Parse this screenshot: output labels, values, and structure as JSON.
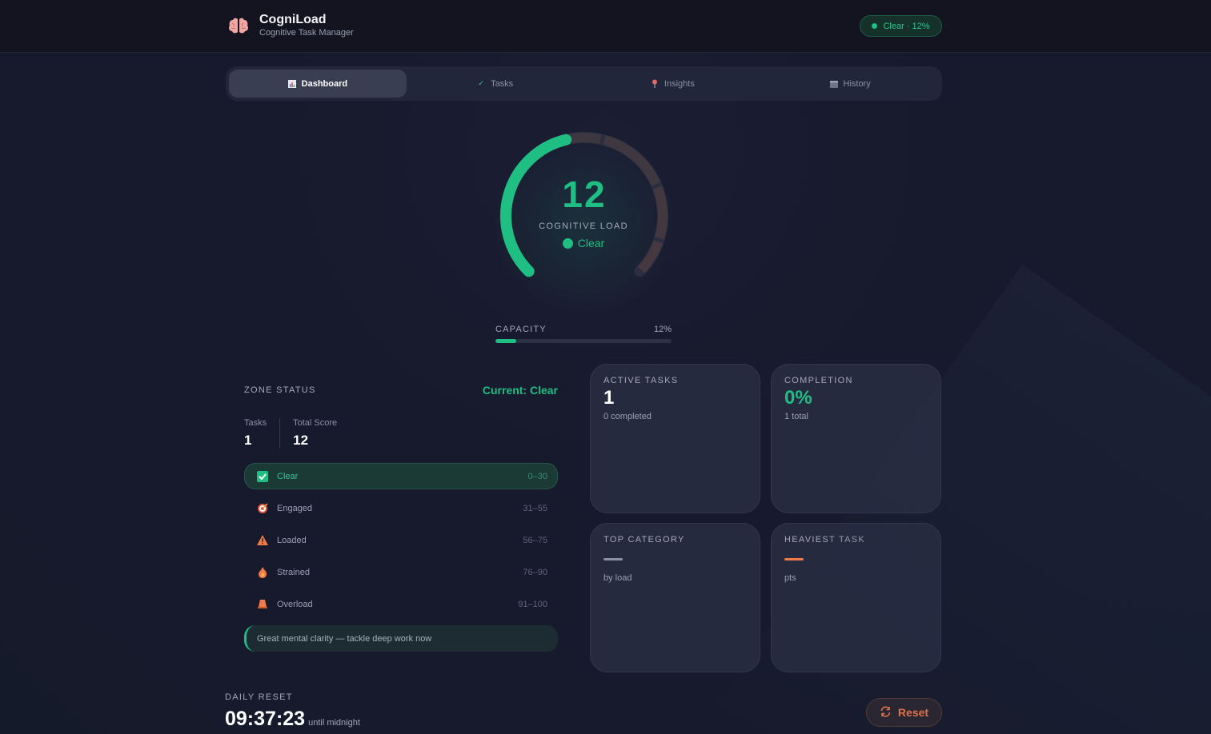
{
  "app": {
    "title": "CogniLoad",
    "subtitle": "Cognitive Task Manager",
    "logo_icon": "brain-icon"
  },
  "header_status": {
    "text": "Clear · 12%",
    "color": "#1fbf84"
  },
  "tabs": [
    {
      "label": "Dashboard",
      "icon": "chart-icon",
      "active": true
    },
    {
      "label": "Tasks",
      "icon": "check-icon",
      "active": false
    },
    {
      "label": "Insights",
      "icon": "pin-icon",
      "active": false
    },
    {
      "label": "History",
      "icon": "calendar-icon",
      "active": false
    }
  ],
  "gauge": {
    "value": "12",
    "label": "COGNITIVE LOAD",
    "zone": "Clear",
    "fraction": 0.12,
    "color": "#1fbf84"
  },
  "capacity": {
    "label": "CAPACITY",
    "percent_text": "12%",
    "fraction": 0.12
  },
  "zone_status": {
    "title": "ZONE STATUS",
    "current": "Current: Clear",
    "tasks_label": "Tasks",
    "tasks_value": "1",
    "score_label": "Total Score",
    "score_value": "12",
    "zones": [
      {
        "name": "Clear",
        "range": "0–30",
        "icon": "checkbox-icon",
        "active": true
      },
      {
        "name": "Engaged",
        "range": "31–55",
        "icon": "target-icon",
        "active": false
      },
      {
        "name": "Loaded",
        "range": "56–75",
        "icon": "warning-icon",
        "active": false
      },
      {
        "name": "Strained",
        "range": "76–90",
        "icon": "flame-icon",
        "active": false
      },
      {
        "name": "Overload",
        "range": "91–100",
        "icon": "cone-icon",
        "active": false
      }
    ],
    "message": "Great mental clarity — tackle deep work now"
  },
  "cards": {
    "active_tasks": {
      "title": "ACTIVE TASKS",
      "value": "1",
      "sub": "0 completed"
    },
    "completion": {
      "title": "COMPLETION",
      "value": "0%",
      "sub": "1 total"
    },
    "top_category": {
      "title": "TOP CATEGORY",
      "sub": "by load",
      "dash_color": "#8b91a6"
    },
    "heaviest_task": {
      "title": "HEAVIEST TASK",
      "sub": "pts",
      "dash_color": "#f07a4a"
    }
  },
  "daily_reset": {
    "label": "DAILY RESET",
    "time": "09:37:23",
    "until": "until midnight"
  },
  "reset_button": {
    "label": "Reset",
    "icon": "refresh-icon"
  }
}
